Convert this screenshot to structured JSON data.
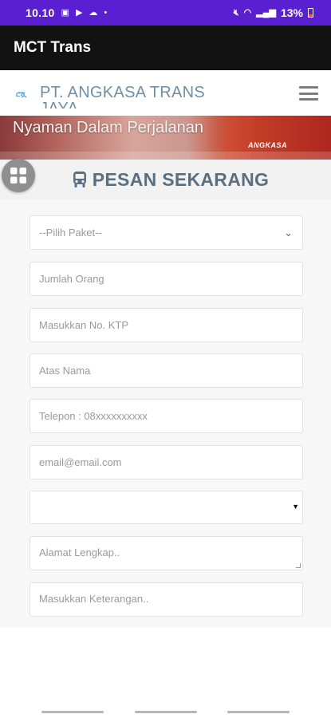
{
  "status_bar": {
    "time": "10.10",
    "battery_text": "13%",
    "icons": [
      "gallery-icon",
      "play-store-icon",
      "cloud-icon",
      "dot-icon",
      "mute-icon",
      "wifi-icon",
      "signal-icon",
      "battery-icon"
    ]
  },
  "app_bar": {
    "title": "MCT Trans"
  },
  "web_header": {
    "logo_text": "ሮሿ",
    "brand": "PT. ANGKASA TRANS JAYA"
  },
  "banner": {
    "tagline": "Nyaman Dalam Perjalanan",
    "bus_label": "ANGKASA"
  },
  "order": {
    "title": "PESAN SEKARANG"
  },
  "form": {
    "package_select": "--Pilih Paket--",
    "jumlah_orang_placeholder": "Jumlah Orang",
    "ktp_placeholder": "Masukkan No. KTP",
    "atas_nama_placeholder": "Atas Nama",
    "telepon_placeholder": "Telepon : 08xxxxxxxxxx",
    "email_placeholder": "email@email.com",
    "blank_select": "",
    "alamat_placeholder": "Alamat Lengkap..",
    "keterangan_placeholder": "Masukkan Keterangan.."
  },
  "colors": {
    "status_bar": "#5a1fd1",
    "app_bar": "#121212",
    "accent_title": "#5b6f80"
  }
}
